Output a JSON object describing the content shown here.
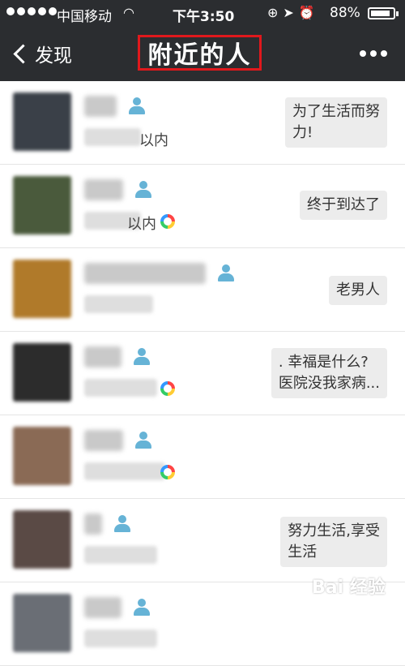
{
  "status": {
    "carrier": "中国移动",
    "time": "下午3:50",
    "battery": "88%",
    "battery_level": 0.88
  },
  "nav": {
    "back_label": "发现",
    "title": "附近的人"
  },
  "rows": [
    {
      "distance_suffix": "以内",
      "gender": "male",
      "has_moments": false,
      "signature": "为了生活而努\n力!",
      "avatar_color": "#3a4048"
    },
    {
      "distance_suffix": "以内",
      "gender": "male",
      "has_moments": true,
      "signature": "终于到达了",
      "avatar_color": "#4a5a3c"
    },
    {
      "distance_suffix": "",
      "gender": "male",
      "has_moments": false,
      "signature": "老男人",
      "avatar_color": "#b07a2a"
    },
    {
      "distance_suffix": "",
      "gender": "male",
      "has_moments": true,
      "signature": ". 幸福是什么?\n医院没我家病...",
      "avatar_color": "#2c2c2c"
    },
    {
      "distance_suffix": "",
      "gender": "male",
      "has_moments": true,
      "signature": "",
      "avatar_color": "#8a6a55"
    },
    {
      "distance_suffix": "",
      "gender": "male",
      "has_moments": false,
      "signature": "努力生活,享受\n生活",
      "avatar_color": "#5a4a45"
    },
    {
      "distance_suffix": "",
      "gender": "male",
      "has_moments": false,
      "signature": "",
      "avatar_color": "#6a6e75"
    }
  ],
  "watermark": "Bai 经验"
}
